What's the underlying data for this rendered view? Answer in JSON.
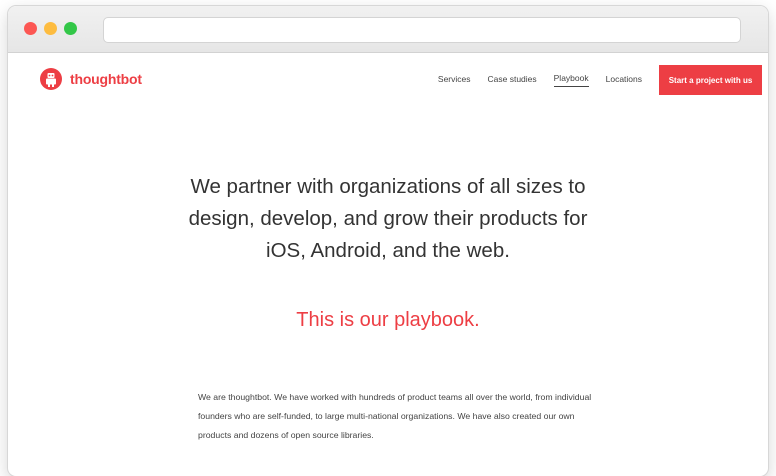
{
  "site": {
    "brand": "thoughtbot",
    "brand_color": "#ed3e44",
    "nav": [
      {
        "label": "Services",
        "active": false
      },
      {
        "label": "Case studies",
        "active": false
      },
      {
        "label": "Playbook",
        "active": true
      },
      {
        "label": "Locations",
        "active": false
      }
    ],
    "cta_label": "Start a project with us"
  },
  "hero": {
    "headline": "We partner with organizations of all sizes to design, develop, and grow their products for iOS, Android, and the web.",
    "tagline": "This is our playbook."
  },
  "intro": {
    "text": "We are thoughtbot. We have worked with hundreds of product teams all over the world, from individual founders who are self-funded, to large multi-national organizations. We have also created our own products and dozens of open source libraries."
  },
  "icons": {
    "window_controls": [
      "close-dot",
      "minimize-dot",
      "zoom-dot"
    ],
    "logo": "robot-logo-icon"
  }
}
